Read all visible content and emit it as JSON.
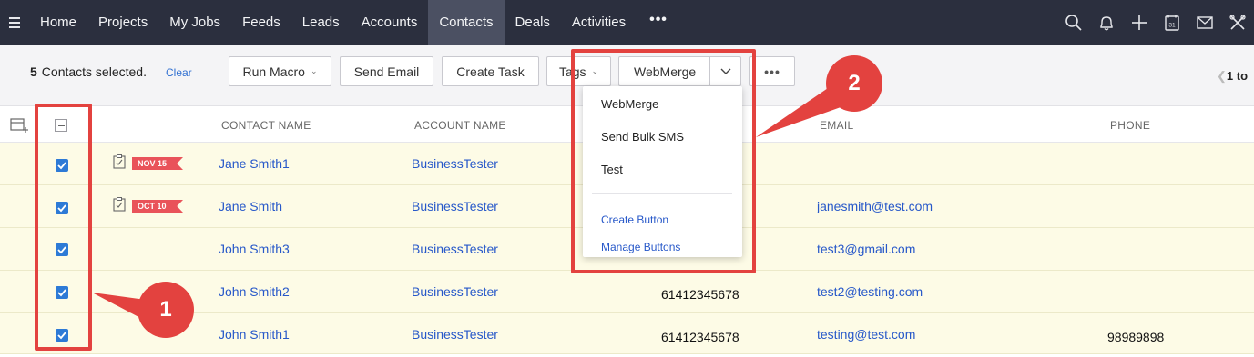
{
  "nav": {
    "items": [
      "Home",
      "Projects",
      "My Jobs",
      "Feeds",
      "Leads",
      "Accounts",
      "Contacts",
      "Deals",
      "Activities"
    ],
    "active": "Contacts",
    "more": "•••",
    "icons": [
      "search-icon",
      "bell-icon",
      "plus-icon",
      "calendar-icon",
      "mail-icon",
      "tools-icon"
    ]
  },
  "calendar_day": "31",
  "toolbar": {
    "count": "5",
    "selected_text": "Contacts selected.",
    "clear": "Clear",
    "run_macro": "Run Macro",
    "send_email": "Send Email",
    "create_task": "Create Task",
    "tags": "Tags",
    "webmerge": "WebMerge",
    "more": "•••",
    "pager": "1 to"
  },
  "table": {
    "headers": [
      "CONTACT NAME",
      "ACCOUNT NAME",
      "EMAIL",
      "PHONE"
    ],
    "rows": [
      {
        "name": "Jane Smith1",
        "account": "BusinessTester",
        "mobile": "",
        "email": "",
        "phone": "",
        "flag": "NOV 15"
      },
      {
        "name": "Jane Smith",
        "account": "BusinessTester",
        "mobile": "",
        "email": "janesmith@test.com",
        "phone": "",
        "flag": "OCT 10"
      },
      {
        "name": "John Smith3",
        "account": "BusinessTester",
        "mobile": "",
        "email": "test3@gmail.com",
        "phone": "",
        "flag": ""
      },
      {
        "name": "John Smith2",
        "account": "BusinessTester",
        "mobile": "61412345678",
        "email": "test2@testing.com",
        "phone": "",
        "flag": ""
      },
      {
        "name": "John Smith1",
        "account": "BusinessTester",
        "mobile": "61412345678",
        "email": "testing@test.com",
        "phone": "98989898",
        "flag": ""
      }
    ]
  },
  "dropdown": {
    "items": [
      "WebMerge",
      "Send Bulk SMS",
      "Test"
    ],
    "links": [
      "Create Button",
      "Manage Buttons"
    ]
  },
  "annotations": {
    "one": "1",
    "two": "2",
    "color": "#e3423f"
  },
  "colors": {
    "nav_bg": "#2b2f3e",
    "row_selected": "#fdfbe6",
    "link": "#2758c9",
    "checkbox": "#2d7ad6"
  }
}
